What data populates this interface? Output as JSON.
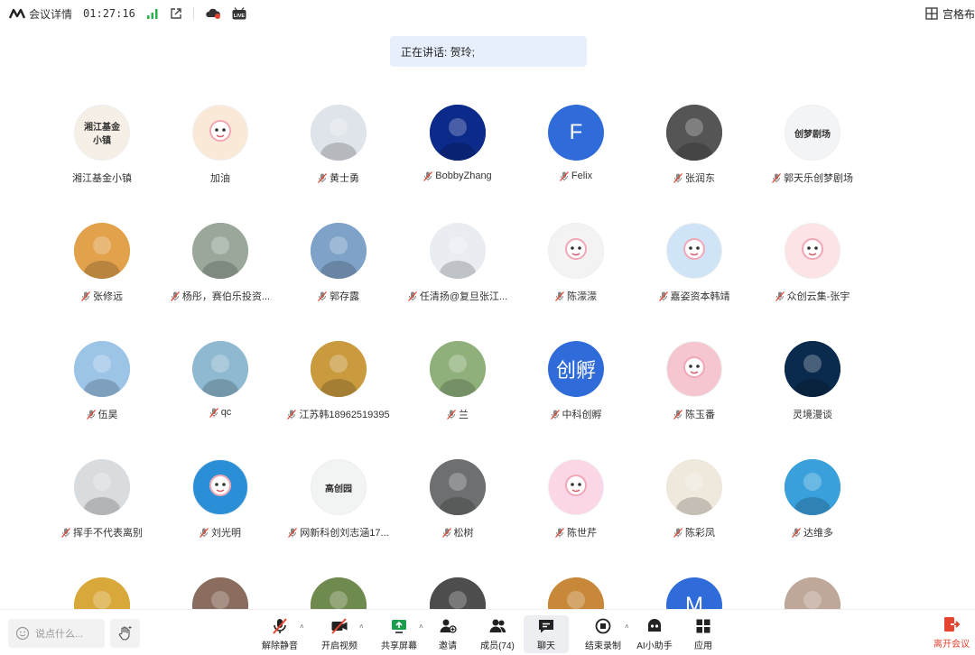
{
  "topbar": {
    "meeting_info_label": "会议详情",
    "elapsed_time": "01:27:16",
    "layout_label": "宫格布",
    "live_badge": "LIVE"
  },
  "speaking": {
    "label": "正在讲话: 贺玲;"
  },
  "colors": {
    "accent": "#2f6bd9",
    "speaking_bg": "#e8effc",
    "leave_red": "#e5442e"
  },
  "participants": [
    {
      "name": "湘江基金小镇",
      "muted": false,
      "avatar_text": "湘江基金小镇",
      "avatar_color": "#f6efe6",
      "avatar_kind": "logo-text"
    },
    {
      "name": "加油",
      "muted": false,
      "avatar_text": "",
      "avatar_color": "#fbe9d8",
      "avatar_kind": "cartoon"
    },
    {
      "name": "黄士勇",
      "muted": true,
      "avatar_text": "",
      "avatar_color": "#dfe3ea",
      "avatar_kind": "photo"
    },
    {
      "name": "BobbyZhang",
      "muted": true,
      "avatar_text": "",
      "avatar_color": "#0b2a8a",
      "avatar_kind": "photo"
    },
    {
      "name": "Felix",
      "muted": true,
      "avatar_text": "F",
      "avatar_color": "#2f6bd9",
      "avatar_kind": "letter"
    },
    {
      "name": "张润东",
      "muted": true,
      "avatar_text": "",
      "avatar_color": "#555555",
      "avatar_kind": "photo"
    },
    {
      "name": "郭天乐创梦剧场",
      "muted": true,
      "avatar_text": "创梦剧场",
      "avatar_color": "#f2f4f5",
      "avatar_kind": "logo-text"
    },
    {
      "name": "张修远",
      "muted": true,
      "avatar_text": "",
      "avatar_color": "#e2a24c",
      "avatar_kind": "photo"
    },
    {
      "name": "杨彤，赛伯乐投资...",
      "muted": true,
      "avatar_text": "",
      "avatar_color": "#9aa89b",
      "avatar_kind": "photo"
    },
    {
      "name": "郭存露",
      "muted": true,
      "avatar_text": "",
      "avatar_color": "#7fa3c8",
      "avatar_kind": "photo"
    },
    {
      "name": "任清扬@复旦张江...",
      "muted": true,
      "avatar_text": "",
      "avatar_color": "#e9edf2",
      "avatar_kind": "photo"
    },
    {
      "name": "陈濛濛",
      "muted": true,
      "avatar_text": "",
      "avatar_color": "#f3f3f3",
      "avatar_kind": "cartoon"
    },
    {
      "name": "嘉姿资本韩靖",
      "muted": true,
      "avatar_text": "",
      "avatar_color": "#cfe4f7",
      "avatar_kind": "cartoon"
    },
    {
      "name": "众创云集-张宇",
      "muted": true,
      "avatar_text": "",
      "avatar_color": "#fde3e6",
      "avatar_kind": "cartoon"
    },
    {
      "name": "伍昊",
      "muted": true,
      "avatar_text": "",
      "avatar_color": "#9cc4e6",
      "avatar_kind": "photo"
    },
    {
      "name": "qc",
      "muted": true,
      "avatar_text": "",
      "avatar_color": "#8fb9d0",
      "avatar_kind": "photo"
    },
    {
      "name": "江苏韩18962519395",
      "muted": true,
      "avatar_text": "",
      "avatar_color": "#c99a3e",
      "avatar_kind": "photo"
    },
    {
      "name": "兰",
      "muted": true,
      "avatar_text": "",
      "avatar_color": "#8fb07a",
      "avatar_kind": "photo"
    },
    {
      "name": "中科创孵",
      "muted": true,
      "avatar_text": "创孵",
      "avatar_color": "#2f6bd9",
      "avatar_kind": "letter"
    },
    {
      "name": "陈玉番",
      "muted": true,
      "avatar_text": "",
      "avatar_color": "#f5c6cf",
      "avatar_kind": "cartoon"
    },
    {
      "name": "灵境漫谈",
      "muted": false,
      "avatar_text": "",
      "avatar_color": "#0b2b4e",
      "avatar_kind": "photo"
    },
    {
      "name": "挥手不代表离别",
      "muted": true,
      "avatar_text": "",
      "avatar_color": "#d9dcdf",
      "avatar_kind": "photo"
    },
    {
      "name": "刘光明",
      "muted": true,
      "avatar_text": "",
      "avatar_color": "#2a8fd6",
      "avatar_kind": "cartoon"
    },
    {
      "name": "网新科创刘志涵17...",
      "muted": true,
      "avatar_text": "高创园",
      "avatar_color": "#f2f4f3",
      "avatar_kind": "logo-text"
    },
    {
      "name": "松树",
      "muted": true,
      "avatar_text": "",
      "avatar_color": "#6d6f70",
      "avatar_kind": "photo"
    },
    {
      "name": "陈世芹",
      "muted": true,
      "avatar_text": "",
      "avatar_color": "#fbd6e6",
      "avatar_kind": "cartoon"
    },
    {
      "name": "陈彩凤",
      "muted": true,
      "avatar_text": "",
      "avatar_color": "#efe8dc",
      "avatar_kind": "photo"
    },
    {
      "name": "达维多",
      "muted": true,
      "avatar_text": "",
      "avatar_color": "#3aa0dc",
      "avatar_kind": "photo"
    },
    {
      "name": "",
      "muted": false,
      "avatar_text": "",
      "avatar_color": "#d9a83a",
      "avatar_kind": "photo"
    },
    {
      "name": "",
      "muted": false,
      "avatar_text": "",
      "avatar_color": "#8a6d5e",
      "avatar_kind": "photo"
    },
    {
      "name": "",
      "muted": false,
      "avatar_text": "",
      "avatar_color": "#6f8a4e",
      "avatar_kind": "photo"
    },
    {
      "name": "",
      "muted": false,
      "avatar_text": "",
      "avatar_color": "#4d4d4d",
      "avatar_kind": "photo"
    },
    {
      "name": "",
      "muted": false,
      "avatar_text": "",
      "avatar_color": "#c7883a",
      "avatar_kind": "photo"
    },
    {
      "name": "",
      "muted": false,
      "avatar_text": "M",
      "avatar_color": "#2f6bd9",
      "avatar_kind": "letter"
    },
    {
      "name": "",
      "muted": false,
      "avatar_text": "",
      "avatar_color": "#bfa79a",
      "avatar_kind": "photo"
    }
  ],
  "bottombar": {
    "chat_placeholder": "说点什么...",
    "tools": [
      {
        "label": "解除静音",
        "icon": "mic-muted-icon",
        "caret": true
      },
      {
        "label": "开启视频",
        "icon": "camera-off-icon",
        "caret": true
      },
      {
        "label": "共享屏幕",
        "icon": "share-screen-icon",
        "caret": true
      },
      {
        "label": "邀请",
        "icon": "invite-icon",
        "caret": false
      },
      {
        "label": "成员(74)",
        "icon": "members-icon",
        "caret": false
      },
      {
        "label": "聊天",
        "icon": "chat-icon",
        "caret": false
      },
      {
        "label": "结束录制",
        "icon": "stop-record-icon",
        "caret": true
      },
      {
        "label": "AI小助手",
        "icon": "ai-assistant-icon",
        "caret": false
      },
      {
        "label": "应用",
        "icon": "apps-icon",
        "caret": false
      }
    ],
    "leave_label": "离开会议"
  }
}
